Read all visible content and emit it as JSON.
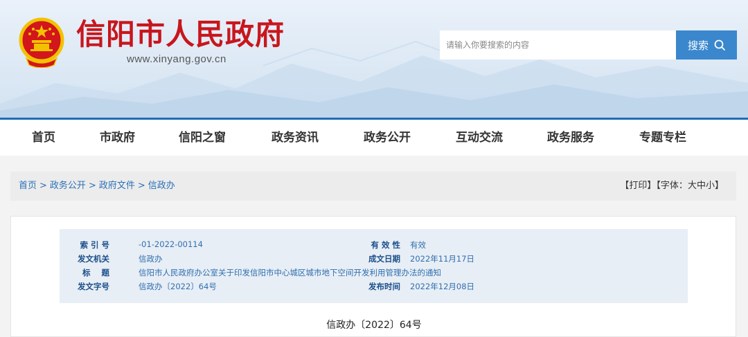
{
  "header": {
    "site_title": "信阳市人民政府",
    "site_domain": "www.xinyang.gov.cn",
    "search_placeholder": "请输入你要搜索的内容",
    "search_button": "搜索"
  },
  "nav": {
    "items": [
      "首页",
      "市政府",
      "信阳之窗",
      "政务资讯",
      "政务公开",
      "互动交流",
      "政务服务",
      "专题专栏"
    ]
  },
  "breadcrumb": {
    "items": [
      "首页",
      "政务公开",
      "政府文件",
      "信政办"
    ],
    "separator": ">"
  },
  "tools": {
    "print": "【打印】",
    "font_prefix": "【字体：",
    "font_big": "大",
    "font_mid": "中",
    "font_small": "小",
    "font_suffix": "】"
  },
  "meta": {
    "index_label": "索 引 号",
    "index_value": "-01-2022-00114",
    "validity_label": "有 效 性",
    "validity_value": "有效",
    "issuer_label": "发文机关",
    "issuer_value": "信政办",
    "date_label": "成文日期",
    "date_value": "2022年11月17日",
    "title_label": "标    题",
    "title_value": "信阳市人民政府办公室关于印发信阳市中心城区城市地下空间开发利用管理办法的通知",
    "docno_label": "发文字号",
    "docno_value": "信政办〔2022〕64号",
    "publish_label": "发布时间",
    "publish_value": "2022年12月08日"
  },
  "doc_number": "信政办〔2022〕64号",
  "colors": {
    "title_red": "#c8161d",
    "nav_blue": "#1f6cb8",
    "search_blue": "#3a87cd",
    "link_blue": "#2a6fb8"
  }
}
